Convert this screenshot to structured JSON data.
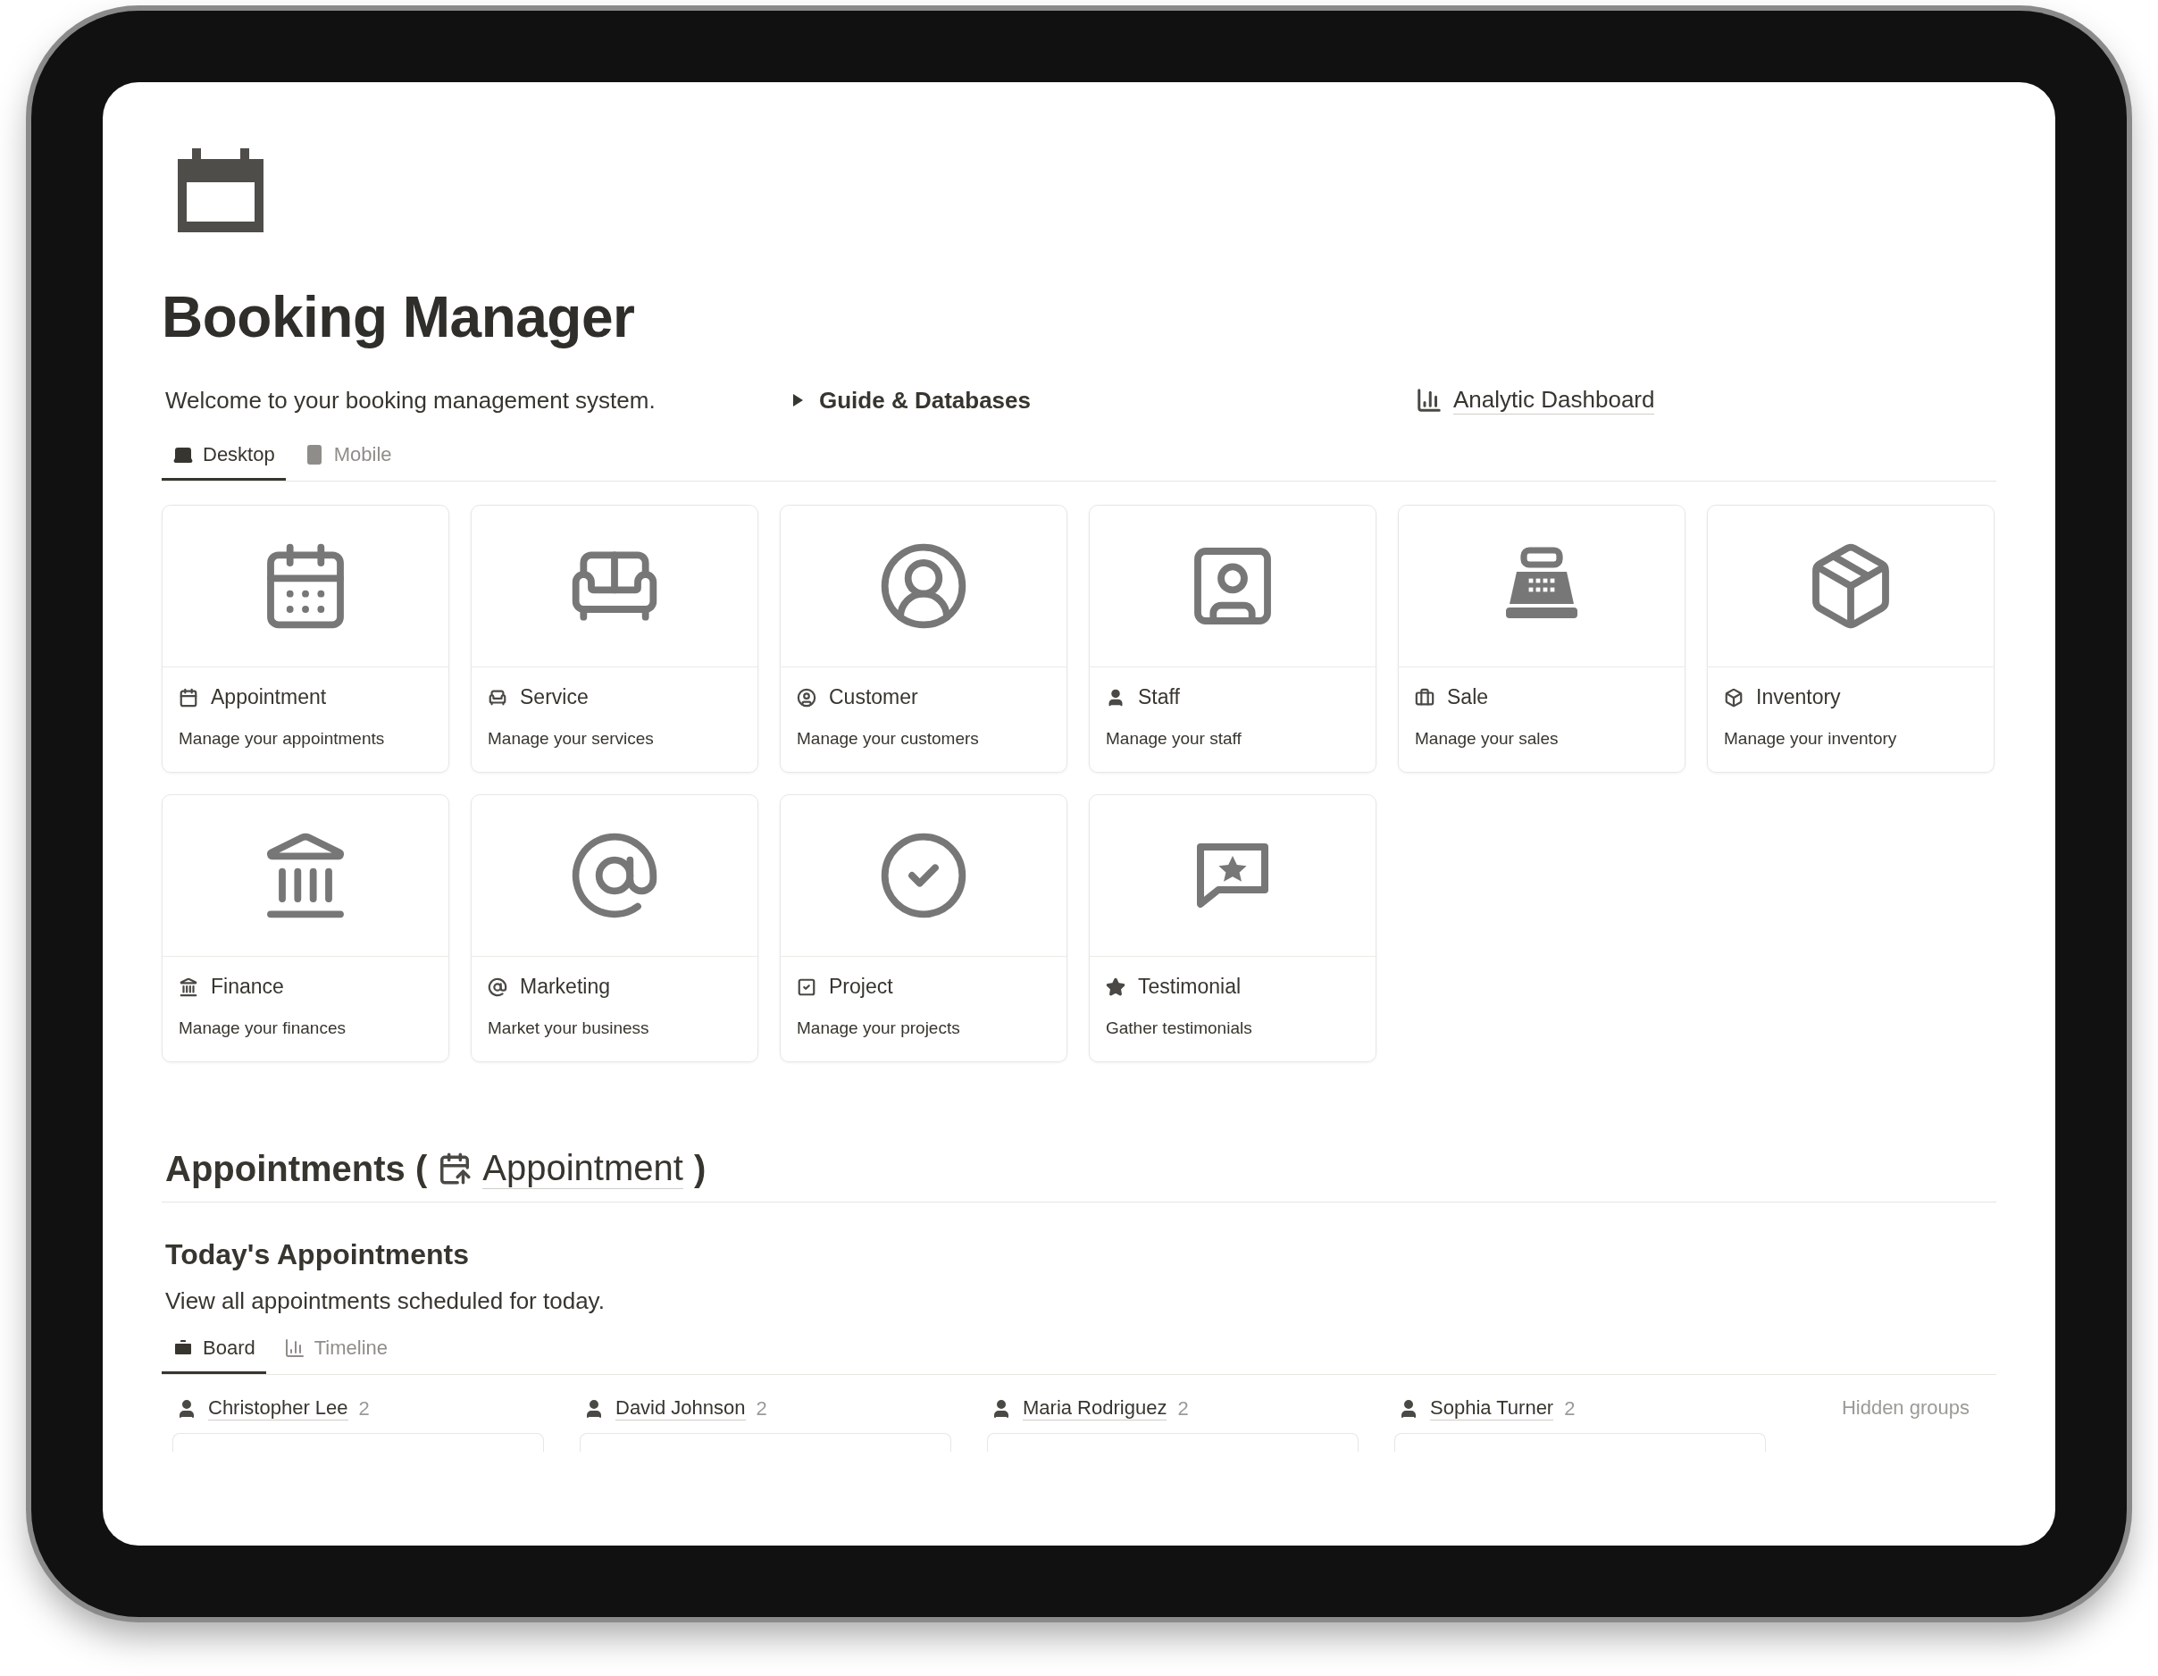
{
  "title": "Booking Manager",
  "intro": {
    "welcome": "Welcome to your booking management system.",
    "toggle": {
      "label": "Guide & Databases",
      "expanded": false
    },
    "link": "Analytic Dashboard"
  },
  "view_tabs": [
    {
      "label": "Desktop",
      "selected": true
    },
    {
      "label": "Mobile",
      "selected": false
    }
  ],
  "cards": [
    {
      "title": "Appointment",
      "description": "Manage your appointments"
    },
    {
      "title": "Service",
      "description": "Manage your services"
    },
    {
      "title": "Customer",
      "description": "Manage your customers"
    },
    {
      "title": "Staff",
      "description": "Manage your staff"
    },
    {
      "title": "Sale",
      "description": "Manage your sales"
    },
    {
      "title": "Inventory",
      "description": "Manage your inventory"
    },
    {
      "title": "Finance",
      "description": "Manage your finances"
    },
    {
      "title": "Marketing",
      "description": "Market your business"
    },
    {
      "title": "Project",
      "description": "Manage your projects"
    },
    {
      "title": "Testimonial",
      "description": "Gather testimonials"
    }
  ],
  "section": {
    "heading": "Appointments (",
    "link": "Appointment",
    "closing": ")"
  },
  "subsection": {
    "title": "Today's Appointments",
    "description": "View all appointments scheduled for today."
  },
  "board_tabs": [
    {
      "label": "Board",
      "selected": true
    },
    {
      "label": "Timeline",
      "selected": false
    }
  ],
  "groups": [
    {
      "name": "Christopher Lee",
      "count": "2"
    },
    {
      "name": "David Johnson",
      "count": "2"
    },
    {
      "name": "Maria Rodriguez",
      "count": "2"
    },
    {
      "name": "Sophia Turner",
      "count": "2"
    }
  ],
  "hidden_groups": "Hidden groups"
}
